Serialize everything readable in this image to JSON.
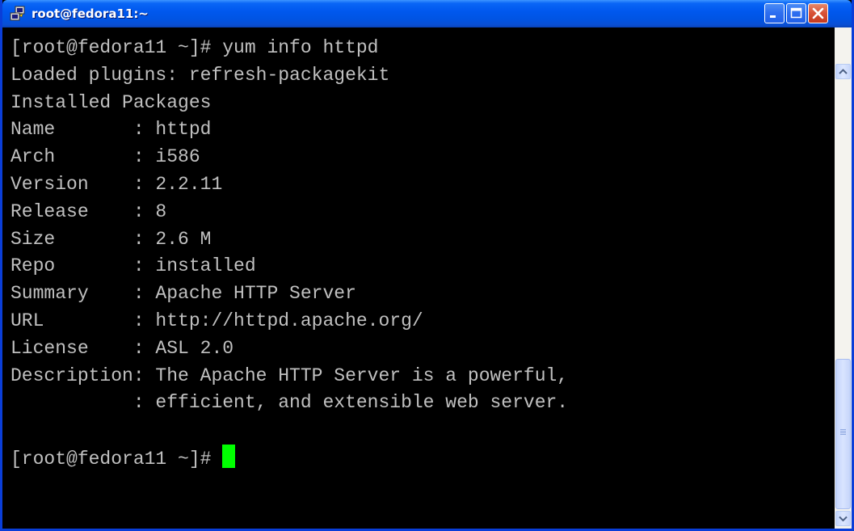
{
  "window": {
    "title": "root@fedora11:~"
  },
  "terminal": {
    "lines": [
      "[root@fedora11 ~]# yum info httpd",
      "Loaded plugins: refresh-packagekit",
      "Installed Packages",
      "Name       : httpd",
      "Arch       : i586",
      "Version    : 2.2.11",
      "Release    : 8",
      "Size       : 2.6 M",
      "Repo       : installed",
      "Summary    : Apache HTTP Server",
      "URL        : http://httpd.apache.org/",
      "License    : ASL 2.0",
      "Description: The Apache HTTP Server is a powerful,",
      "           : efficient, and extensible web server.",
      "",
      "[root@fedora11 ~]# "
    ],
    "cursor_color": "#00ff00",
    "text_color": "#c0c0c0",
    "background_color": "#000000"
  },
  "icons": {
    "app": "putty-icon",
    "minimize": "minimize-icon",
    "maximize": "maximize-icon",
    "close": "close-icon",
    "scroll_up": "scroll-up-arrow-icon",
    "scroll_down": "scroll-down-arrow-icon",
    "scroll_grip": "scroll-grip-icon"
  },
  "colors": {
    "titlebar": "#0054e3",
    "close_button": "#d9553a"
  }
}
